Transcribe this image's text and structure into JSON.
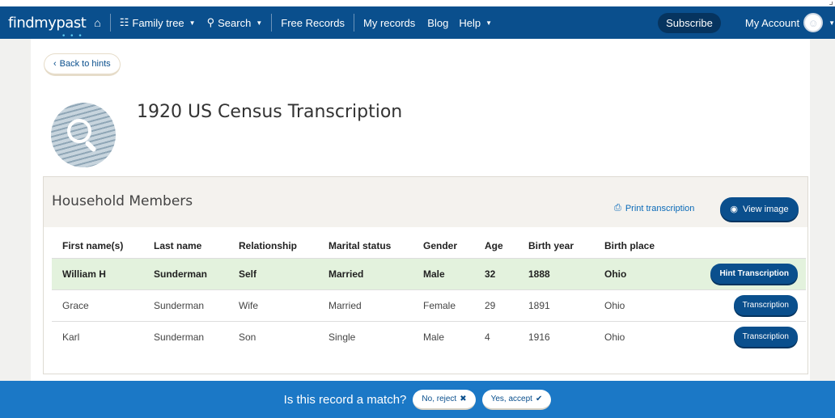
{
  "nav": {
    "logo": "findmypast",
    "logo_dots": "• • •",
    "home_icon": "home-icon",
    "family_tree": "Family tree",
    "family_tree_icon": "sitemap-icon",
    "search": "Search",
    "search_icon": "search-icon",
    "free_records": "Free Records",
    "my_records": "My records",
    "blog": "Blog",
    "help": "Help",
    "subscribe": "Subscribe",
    "my_account": "My Account"
  },
  "back_label": "Back to hints",
  "page_title": "1920 US Census Transcription",
  "panel": {
    "title": "Household Members",
    "print_label": "Print transcription",
    "view_image_label": "View image"
  },
  "table": {
    "headers": [
      "First name(s)",
      "Last name",
      "Relationship",
      "Marital status",
      "Gender",
      "Age",
      "Birth year",
      "Birth place"
    ],
    "rows": [
      {
        "first": "William H",
        "last": "Sunderman",
        "relationship": "Self",
        "marital": "Married",
        "gender": "Male",
        "age": "32",
        "birth_year": "1888",
        "birth_place": "Ohio",
        "button": "Hint Transcription"
      },
      {
        "first": "Grace",
        "last": "Sunderman",
        "relationship": "Wife",
        "marital": "Married",
        "gender": "Female",
        "age": "29",
        "birth_year": "1891",
        "birth_place": "Ohio",
        "button": "Transcription"
      },
      {
        "first": "Karl",
        "last": "Sunderman",
        "relationship": "Son",
        "marital": "Single",
        "gender": "Male",
        "age": "4",
        "birth_year": "1916",
        "birth_place": "Ohio",
        "button": "Transcription"
      }
    ]
  },
  "footer": {
    "question": "Is this record a match?",
    "reject": "No, reject",
    "accept": "Yes, accept"
  },
  "colors": {
    "nav_bg": "#0a4f8d",
    "footer_bg": "#1b78c6",
    "highlight_row": "#e3f2dd",
    "button_bg": "#0a4f8d"
  }
}
